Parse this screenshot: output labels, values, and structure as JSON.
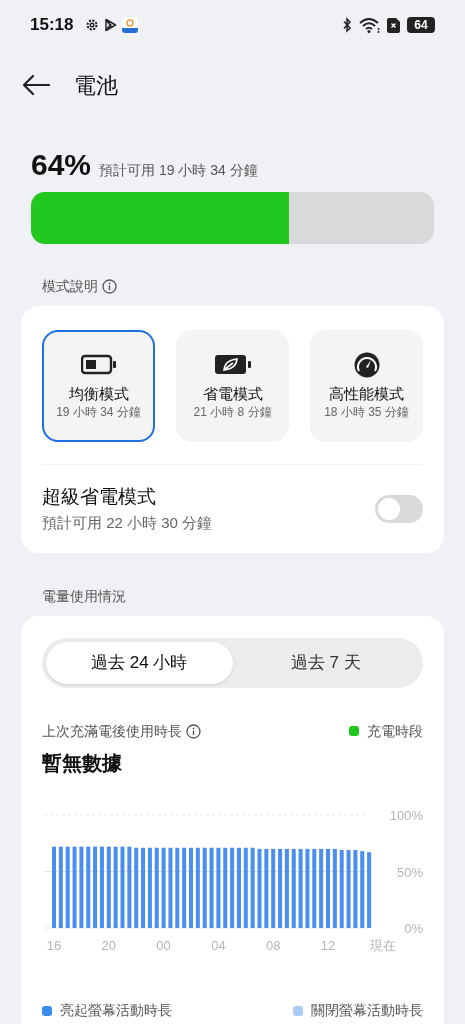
{
  "status_bar": {
    "time": "15:18",
    "battery": "64"
  },
  "header": {
    "title": "電池"
  },
  "battery": {
    "percent": "64%",
    "estimate": "預計可用 19 小時 34 分鐘",
    "level": 0.64
  },
  "modes_section": {
    "title": "模式說明"
  },
  "modes": [
    {
      "kind": "balanced",
      "name": "均衡模式",
      "time": "19 小時 34 分鐘",
      "selected": true
    },
    {
      "kind": "saver",
      "name": "省電模式",
      "time": "21 小時 8 分鐘",
      "selected": false
    },
    {
      "kind": "performance",
      "name": "高性能模式",
      "time": "18 小時 35 分鐘",
      "selected": false
    }
  ],
  "super_saver": {
    "title": "超級省電模式",
    "subtitle": "預計可用 22 小時 30 分鐘",
    "on": false
  },
  "usage_section": {
    "title": "電量使用情況"
  },
  "range_tabs": [
    {
      "label": "過去 24 小時",
      "selected": true
    },
    {
      "label": "過去 7 天",
      "selected": false
    }
  ],
  "usage": {
    "label": "上次充滿電後使用時長",
    "value": "暫無數據",
    "charging_legend": "充電時段",
    "x_labels": [
      "16",
      "20",
      "00",
      "04",
      "08",
      "12",
      "現在"
    ],
    "chart_data": {
      "type": "bar",
      "ylim": [
        0,
        100
      ],
      "yticks": [
        {
          "value": 0,
          "label": "0%"
        },
        {
          "value": 50,
          "label": "50%"
        },
        {
          "value": 100,
          "label": "100%"
        }
      ],
      "series": [
        {
          "color": "#4a8ef0",
          "values": [
            72,
            72,
            72,
            72,
            72,
            72,
            72,
            72,
            72,
            72,
            72,
            72,
            71,
            71,
            71,
            71,
            71,
            71,
            71,
            71,
            71,
            71,
            71,
            71,
            71,
            71,
            71,
            71,
            71,
            71,
            70,
            70,
            70,
            70,
            70,
            70,
            70,
            70,
            70,
            70,
            70,
            70,
            69,
            69,
            69,
            68,
            67
          ]
        }
      ]
    }
  },
  "legend": [
    {
      "label": "亮起螢幕活動時長",
      "color": "#3b8beb"
    },
    {
      "label": "關閉螢幕活動時長",
      "color": "#a9cdf5"
    }
  ]
}
